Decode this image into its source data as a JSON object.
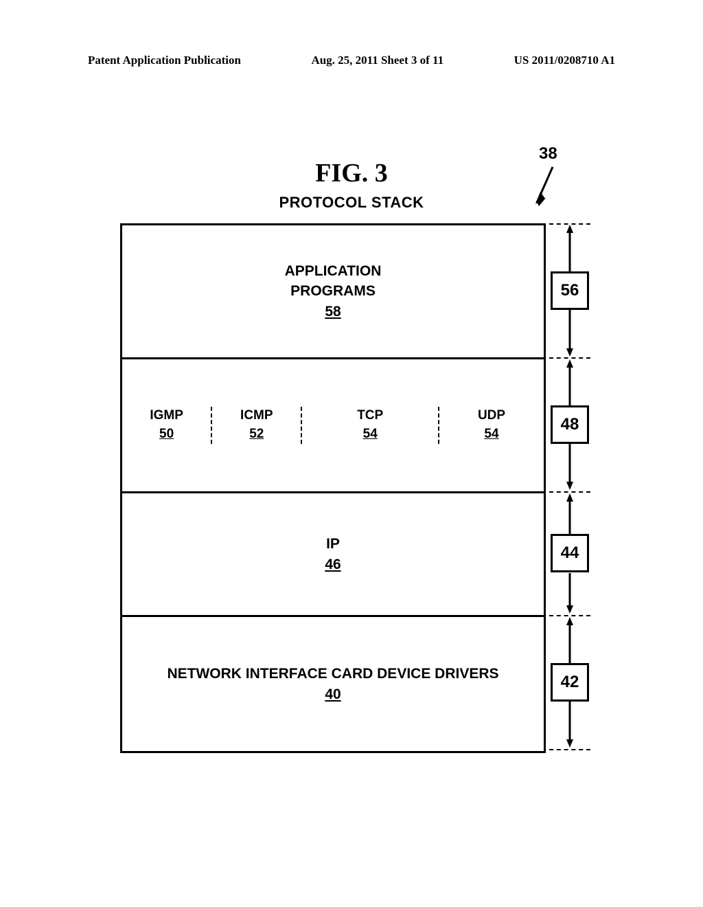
{
  "header": {
    "left": "Patent Application Publication",
    "center": "Aug. 25, 2011  Sheet 3 of 11",
    "right": "US 2011/0208710 A1"
  },
  "figure": {
    "title": "FIG. 3",
    "subtitle": "PROTOCOL STACK",
    "pointer_ref": "38"
  },
  "layers": {
    "application": {
      "line1": "APPLICATION",
      "line2": "PROGRAMS",
      "ref": "58"
    },
    "transport": {
      "igmp": {
        "label": "IGMP",
        "ref": "50"
      },
      "icmp": {
        "label": "ICMP",
        "ref": "52"
      },
      "tcp": {
        "label": "TCP",
        "ref": "54"
      },
      "udp": {
        "label": "UDP",
        "ref": "54"
      }
    },
    "ip": {
      "label": "IP",
      "ref": "46"
    },
    "nic": {
      "label": "NETWORK INTERFACE CARD DEVICE DRIVERS",
      "ref": "40"
    }
  },
  "side_refs": {
    "app_layer": "56",
    "transport_layer": "48",
    "ip_layer": "44",
    "nic_layer": "42"
  }
}
